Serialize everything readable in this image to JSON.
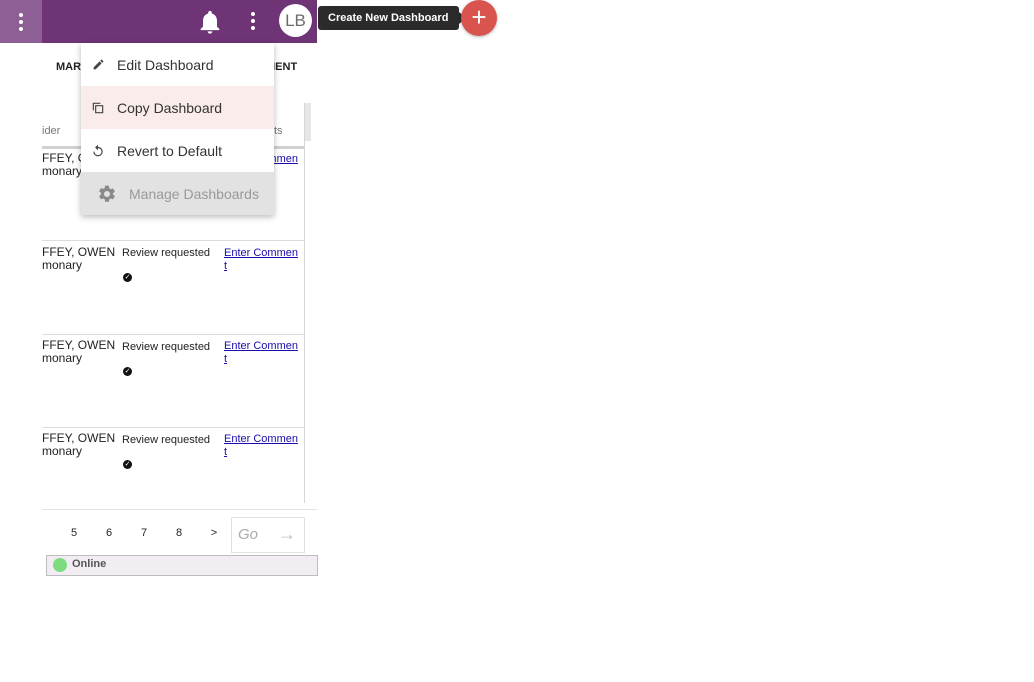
{
  "topbar": {
    "avatar_initials": "LB",
    "tooltip": "Create New Dashboard",
    "fab_symbol": "+",
    "colors": {
      "bar": "#6e3476",
      "fab": "#d9534f"
    }
  },
  "tabs": {
    "left_partial": "MARI",
    "right_partial": "MENT"
  },
  "table": {
    "headers": {
      "provider_partial": "ider",
      "comments_partial": "ts"
    },
    "rows": [
      {
        "provider": "FFEY, OWEN",
        "provider_sub": "monary",
        "status": "",
        "comment_link": "Enter Commen",
        "comment_link_2": ""
      },
      {
        "provider": "FFEY, OWEN",
        "provider_sub": "monary",
        "status": "Review requested",
        "comment_link": "Enter Commen",
        "comment_link_2": "t"
      },
      {
        "provider": "FFEY, OWEN",
        "provider_sub": "monary",
        "status": "Review requested",
        "comment_link": "Enter Commen",
        "comment_link_2": "t"
      },
      {
        "provider": "FFEY, OWEN",
        "provider_sub": "monary",
        "status": "Review requested",
        "comment_link": "Enter Commen",
        "comment_link_2": "t"
      }
    ]
  },
  "pagination": {
    "pages": [
      "5",
      "6",
      "7",
      "8"
    ],
    "next": ">",
    "go_placeholder": "Go"
  },
  "status": {
    "label": "Online"
  },
  "menu": {
    "items": [
      {
        "label": "Edit Dashboard",
        "icon": "pencil-icon"
      },
      {
        "label": "Copy Dashboard",
        "icon": "copy-icon"
      },
      {
        "label": "Revert to Default",
        "icon": "revert-icon"
      },
      {
        "label": "Manage Dashboards",
        "icon": "gear-icon"
      }
    ]
  }
}
